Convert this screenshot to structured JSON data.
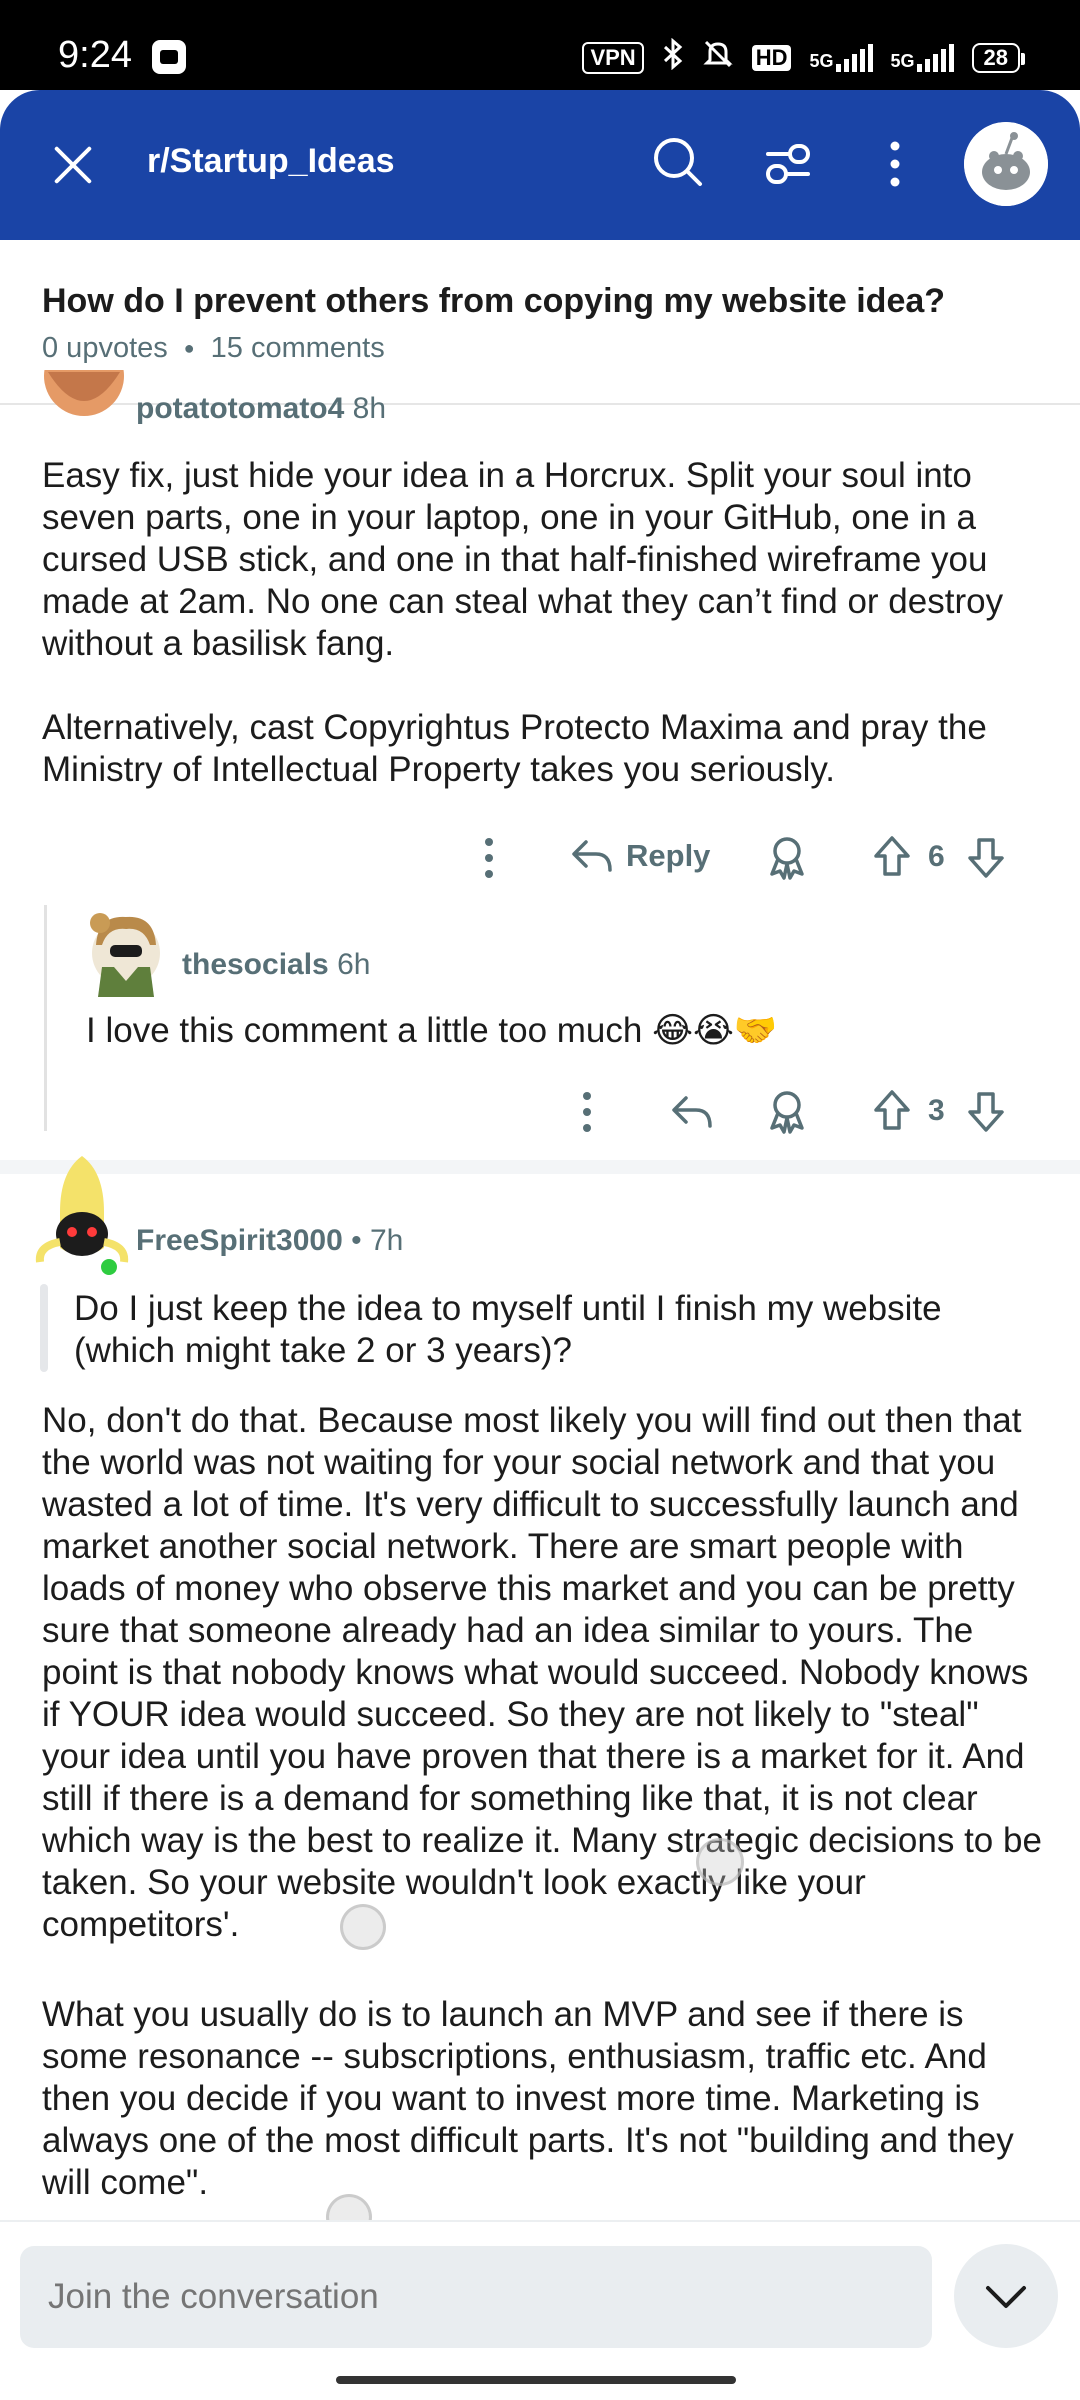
{
  "status_bar": {
    "time": "9:24",
    "vpn": "VPN",
    "hd": "HD",
    "net1": "5G",
    "net2": "5G",
    "battery": "28"
  },
  "header": {
    "subreddit": "r/Startup_Ideas",
    "accent_color": "#1a44a6"
  },
  "post": {
    "title": "How do I prevent others from copying my website idea?",
    "upvotes": "0 upvotes",
    "comments": "15 comments"
  },
  "comments": [
    {
      "username": "potatotomato4",
      "age": "8h",
      "paragraphs": [
        "Easy fix, just hide your idea in a Horcrux. Split your soul into seven parts, one in your laptop, one in your GitHub, one in a cursed USB stick, and one in that half-finished wireframe you made at 2am. No one can steal what they can’t find or destroy without a basilisk fang.",
        "Alternatively, cast Copyrightus Protecto Maxima and pray the Ministry of Intellectual Property takes you seriously."
      ],
      "reply_label": "Reply",
      "votes": "6"
    },
    {
      "username": "thesocials",
      "age": "6h",
      "text": "I love this comment a little too much 😂😭🤝",
      "votes": "3"
    },
    {
      "username": "FreeSpirit3000",
      "age": "• 7h",
      "quote": "Do I just keep the idea to myself until I finish my website (which might take 2 or 3 years)?",
      "paragraphs": [
        "No, don't do that. Because most likely you will find out then that the world was not waiting for your social network and that you wasted a lot of time. It's very difficult to successfully launch and market another social network. There are smart people with loads of money who observe this market and you can be pretty sure that someone already had an idea similar to yours. The point is that nobody knows what would succeed. Nobody knows if YOUR idea would succeed. So they are not likely to \"steal\" your idea until you have proven that there is a market for it. And still if there is a demand for something like that, it is not clear which way is the best to realize it. Many strategic decisions to be taken. So your website wouldn't look exactly like your competitors'.",
        "What you usually do is to launch an MVP and see if there is some resonance -- subscriptions, enthusiasm, traffic etc. And then you decide if you want to invest more time. Marketing is always one of the most difficult parts. It's not \"building and they will come\"."
      ]
    }
  ],
  "composer": {
    "placeholder": "Join the conversation"
  }
}
